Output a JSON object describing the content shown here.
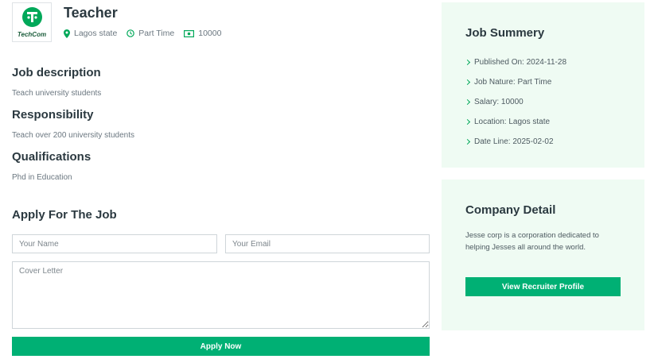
{
  "job": {
    "title": "Teacher",
    "location": "Lagos state",
    "nature": "Part Time",
    "salary": "10000"
  },
  "logo": {
    "text": "TechCom",
    "color": "#00a859"
  },
  "sections": {
    "description_title": "Job description",
    "description_text": "Teach university students",
    "responsibility_title": "Responsibility",
    "responsibility_text": "Teach over 200 university students",
    "qualifications_title": "Qualifications",
    "qualifications_text": "Phd in Education"
  },
  "apply": {
    "title": "Apply For The Job",
    "name_placeholder": "Your Name",
    "email_placeholder": "Your Email",
    "cover_placeholder": "Cover Letter",
    "button_label": "Apply Now"
  },
  "summary": {
    "title": "Job Summery",
    "items": [
      "Published On: 2024-11-28",
      "Job Nature: Part Time",
      "Salary: 10000",
      "Location: Lagos state",
      "Date Line: 2025-02-02"
    ]
  },
  "company": {
    "title": "Company Detail",
    "description": "Jesse corp is a corporation dedicated to helping Jesses all around the world.",
    "button_label": "View Recruiter Profile"
  },
  "colors": {
    "accent": "#00b074",
    "panel_bg": "#effbf3"
  }
}
